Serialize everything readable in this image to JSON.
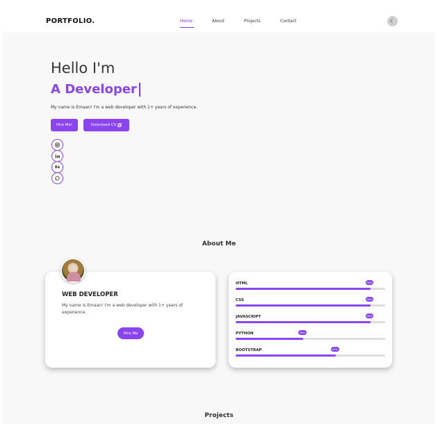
{
  "header": {
    "logo": "PORTFOLIO.",
    "nav": [
      {
        "label": "Home",
        "active": true
      },
      {
        "label": "About",
        "active": false
      },
      {
        "label": "Projects",
        "active": false
      },
      {
        "label": "Contact",
        "active": false
      }
    ],
    "theme_icon": "moon-icon"
  },
  "hero": {
    "greeting": "Hello I'm",
    "role": "A Developer",
    "intro": "My name is Emaan! I'm a web developer with 1+ years of experience.",
    "hire_label": "Hire Me!",
    "download_label": "Download CV",
    "download_icon": "copy-icon",
    "socials": [
      "instagram-icon",
      "linkedin-icon",
      "behance-icon",
      "whatsapp-icon"
    ]
  },
  "about": {
    "section_title": "About Me",
    "card_title": "WEB DEVELOPER",
    "card_text": "My name is Emaan! I'm a web developer with 1+ years of experience.",
    "hire_label": "Hire Me"
  },
  "skills": [
    {
      "name": "HTML",
      "percent": 90,
      "badge": "90%"
    },
    {
      "name": "CSS",
      "percent": 90,
      "badge": "90%"
    },
    {
      "name": "JAVASCRIPT",
      "percent": 90,
      "badge": "90%"
    },
    {
      "name": "PYTHON",
      "percent": 45,
      "badge": "45%"
    },
    {
      "name": "BOOTSTRAP",
      "percent": 67,
      "badge": "67%"
    }
  ],
  "projects": {
    "section_title": "Projects"
  },
  "colors": {
    "accent": "#8b45f0",
    "background": "#f8f8f8"
  }
}
